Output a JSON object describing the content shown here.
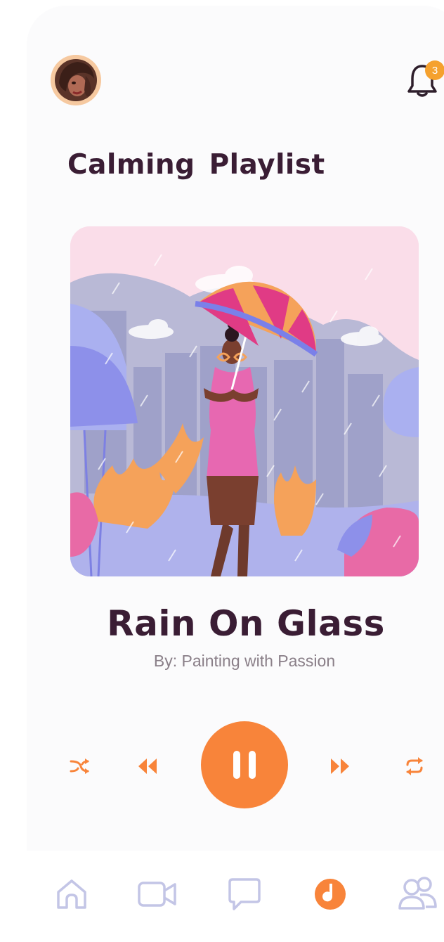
{
  "header": {
    "avatar_icon": "user-avatar",
    "notifications": {
      "icon": "bell-icon",
      "count": "3"
    }
  },
  "playlist": {
    "title": "Calming  Playlist"
  },
  "now_playing": {
    "artwork_icon": "woman-with-umbrella-in-rain-illustration",
    "title": "Rain On Glass",
    "artist": "By: Painting with Passion",
    "state": "playing"
  },
  "controls": {
    "accent": "#f8843a",
    "items": [
      "shuffle-icon",
      "rewind-icon",
      "pause-icon",
      "fast-forward-icon",
      "repeat-icon"
    ]
  },
  "bottom_nav": {
    "items": [
      {
        "icon": "home-icon",
        "active": false
      },
      {
        "icon": "video-camera-icon",
        "active": false
      },
      {
        "icon": "chat-bubble-icon",
        "active": false
      },
      {
        "icon": "music-disc-icon",
        "active": true
      },
      {
        "icon": "users-icon",
        "active": false
      }
    ],
    "inactive_color": "#c3c5e6",
    "active_color": "#f8843a"
  },
  "colors": {
    "heading": "#3a1d34",
    "subtext": "#8a7f88",
    "badge": "#f5a12e"
  }
}
